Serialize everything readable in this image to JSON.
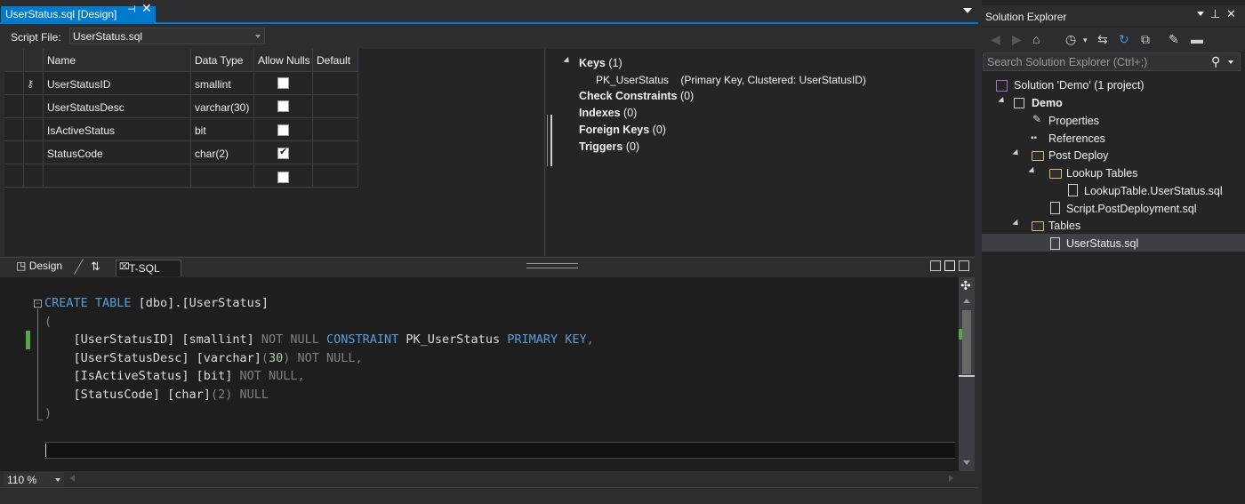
{
  "document_tab": {
    "title": "UserStatus.sql [Design]",
    "pin": "⊣",
    "close": "✕"
  },
  "script_file": {
    "label": "Script File:",
    "value": "UserStatus.sql"
  },
  "grid": {
    "headers": [
      "Name",
      "Data Type",
      "Allow Nulls",
      "Default"
    ],
    "rows": [
      {
        "name": "UserStatusID",
        "type": "smallint",
        "allow_nulls": false,
        "key": true
      },
      {
        "name": "UserStatusDesc",
        "type": "varchar(30)",
        "allow_nulls": false
      },
      {
        "name": "IsActiveStatus",
        "type": "bit",
        "allow_nulls": false
      },
      {
        "name": "StatusCode",
        "type": "char(2)",
        "allow_nulls": true
      },
      {
        "name": "",
        "type": "",
        "allow_nulls": false
      }
    ]
  },
  "properties": {
    "keys": {
      "label": "Keys",
      "count": "(1)"
    },
    "pk": {
      "name": "PK_UserStatus",
      "detail": "(Primary Key, Clustered: UserStatusID)"
    },
    "check": {
      "label": "Check Constraints",
      "count": "(0)"
    },
    "indexes": {
      "label": "Indexes",
      "count": "(0)"
    },
    "fks": {
      "label": "Foreign Keys",
      "count": "(0)"
    },
    "triggers": {
      "label": "Triggers",
      "count": "(0)"
    }
  },
  "design_tabs": {
    "design": "Design",
    "swap": "⇅",
    "tsql": "T-SQL"
  },
  "code": {
    "l1_kw": "CREATE TABLE",
    "l1_rest": " [dbo].[UserStatus]",
    "l2": "(",
    "l3_a": "    [UserStatusID] [smallint] ",
    "l3_b": "NOT NULL ",
    "l3_c": "CONSTRAINT",
    "l3_d": " PK_UserStatus ",
    "l3_e": "PRIMARY KEY",
    "l3_f": ",",
    "l4_a": "    [UserStatusDesc] [varchar]",
    "l4_b": "(",
    "l4_c": "30",
    "l4_d": ") NOT NULL,",
    "l5_a": "    [IsActiveStatus] [bit] ",
    "l5_b": "NOT NULL,",
    "l6_a": "    [StatusCode] [char]",
    "l6_b": "(2) NULL",
    "l7": ")"
  },
  "zoom": "110 %",
  "solution_explorer": {
    "title": "Solution Explorer",
    "search_placeholder": "Search Solution Explorer (Ctrl+;)",
    "items": [
      {
        "label": "Solution 'Demo' (1 project)"
      },
      {
        "label": "Demo"
      },
      {
        "label": "Properties"
      },
      {
        "label": "References"
      },
      {
        "label": "Post Deploy"
      },
      {
        "label": "Lookup Tables"
      },
      {
        "label": "LookupTable.UserStatus.sql"
      },
      {
        "label": "Script.PostDeployment.sql"
      },
      {
        "label": "Tables"
      },
      {
        "label": "UserStatus.sql"
      }
    ]
  }
}
